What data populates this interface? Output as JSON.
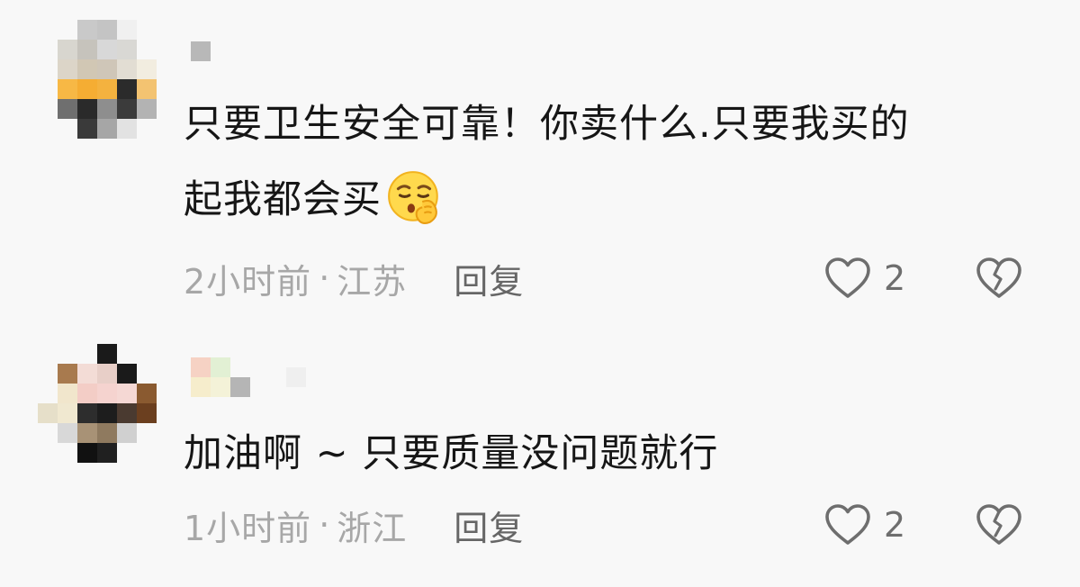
{
  "comments": [
    {
      "text_line1": "只要卫生安全可靠！你卖什么.只要我买的",
      "text_line2": "起我都会买",
      "emoji_icon": "shushing-face-emoji",
      "time": "2小时前",
      "separator": "·",
      "location": "江苏",
      "reply_label": "回复",
      "like_count": "2",
      "like_icon": "heart-outline-icon",
      "dislike_icon": "broken-heart-icon"
    },
    {
      "text_line1": "加油啊 ~ 只要质量没问题就行",
      "time": "1小时前",
      "separator": "·",
      "location": "浙江",
      "reply_label": "回复",
      "like_count": "2",
      "like_icon": "heart-outline-icon",
      "dislike_icon": "broken-heart-icon"
    }
  ],
  "colors": {
    "background": "#f8f8f8",
    "text_primary": "#161616",
    "text_meta": "#a7a7a7",
    "reply": "#666666",
    "icon": "#6e6e6e"
  }
}
